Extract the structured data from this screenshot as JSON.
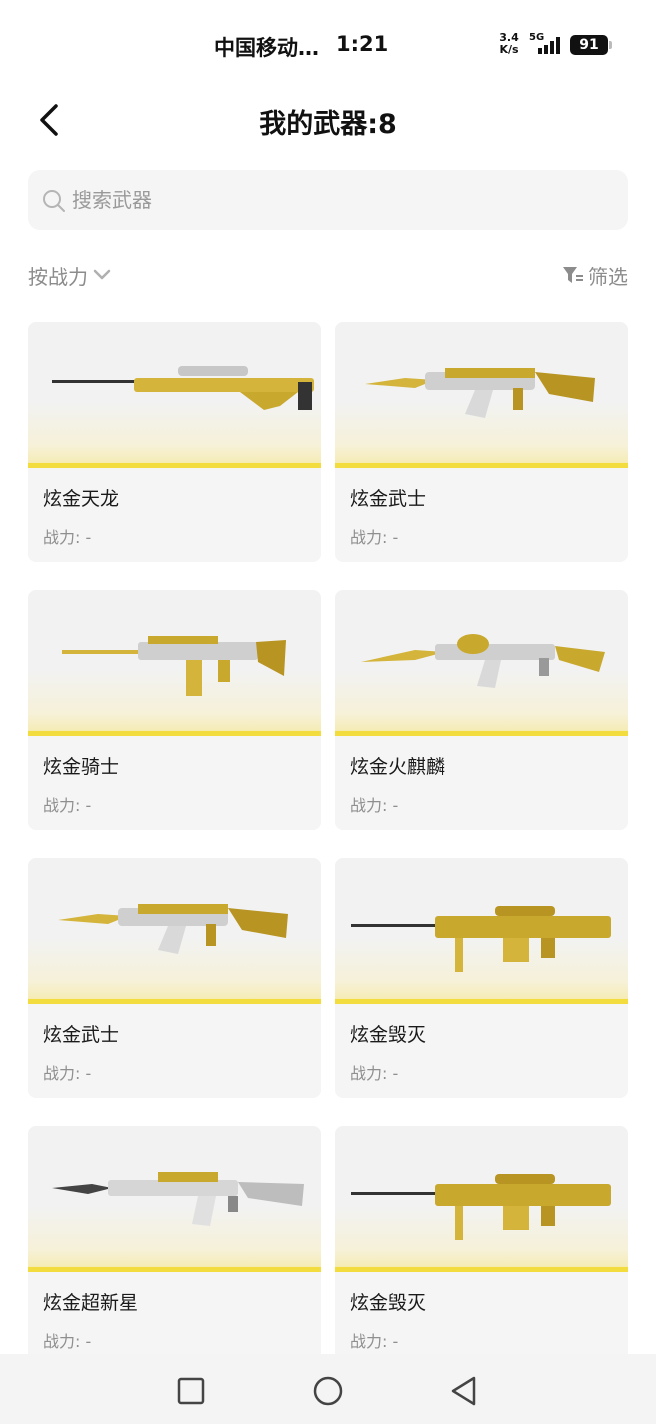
{
  "status_bar": {
    "carrier": "中国移动…",
    "time": "1:21",
    "speed_value": "3.4",
    "speed_unit": "K/s",
    "network": "5G",
    "battery": "91"
  },
  "header": {
    "title": "我的武器:8"
  },
  "search": {
    "placeholder": "搜索武器",
    "value": ""
  },
  "toolbar": {
    "sort_label": "按战力",
    "filter_label": "筛选"
  },
  "weapons": [
    {
      "name": "炫金天龙",
      "power": "战力: -",
      "icon": "sniper-rifle-icon"
    },
    {
      "name": "炫金武士",
      "power": "战力: -",
      "icon": "assault-rifle-icon"
    },
    {
      "name": "炫金骑士",
      "power": "战力: -",
      "icon": "assault-rifle-icon"
    },
    {
      "name": "炫金火麒麟",
      "power": "战力: -",
      "icon": "assault-rifle-icon"
    },
    {
      "name": "炫金武士",
      "power": "战力: -",
      "icon": "assault-rifle-icon"
    },
    {
      "name": "炫金毁灭",
      "power": "战力: -",
      "icon": "sniper-rifle-icon"
    },
    {
      "name": "炫金超新星",
      "power": "战力: -",
      "icon": "assault-rifle-icon"
    },
    {
      "name": "炫金毁灭",
      "power": "战力: -",
      "icon": "sniper-rifle-icon"
    }
  ],
  "colors": {
    "accent_gold": "#d9b93a",
    "card_bg": "#f5f5f5",
    "muted_text": "#8c8c8c"
  },
  "nav": {
    "icons": [
      "recent-apps-icon",
      "home-icon",
      "back-icon"
    ]
  }
}
